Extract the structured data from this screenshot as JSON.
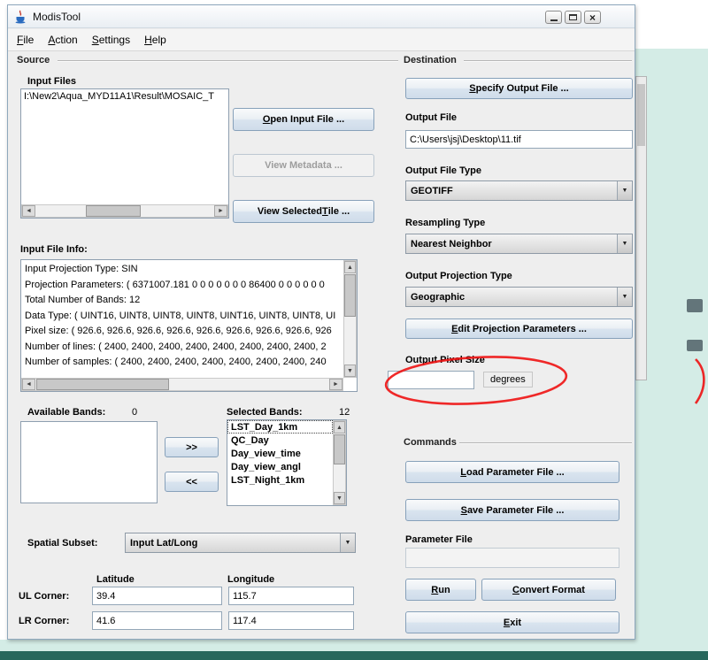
{
  "window": {
    "title": "ModisTool"
  },
  "menu": {
    "items": [
      {
        "label": "File",
        "mi": 0
      },
      {
        "label": "Action",
        "mi": 0
      },
      {
        "label": "Settings",
        "mi": 0
      },
      {
        "label": "Help",
        "mi": 0
      }
    ]
  },
  "source": {
    "section_label": "Source",
    "input_files_label": "Input Files",
    "input_file_path": "I:\\New2\\Aqua_MYD11A1\\Result\\MOSAIC_T",
    "open_button": {
      "label": "Open Input File ...",
      "mi": 0
    },
    "metadata_button": {
      "label": "View Metadata ...",
      "mi": -1
    },
    "view_tile_button": {
      "label": "View Selected Tile ...",
      "mi": 14
    },
    "file_info_label": "Input File Info:",
    "file_info_lines": [
      "Input Projection Type: SIN",
      "Projection Parameters: ( 6371007.181 0 0 0 0 0 0 0 86400 0 0 0 0 0 0",
      "Total Number of Bands: 12",
      "Data Type: ( UINT16, UINT8, UINT8, UINT8, UINT16, UINT8, UINT8, UI",
      "Pixel size: ( 926.6, 926.6, 926.6, 926.6, 926.6, 926.6, 926.6, 926.6, 926",
      "Number of lines: ( 2400, 2400, 2400, 2400, 2400, 2400, 2400, 2400, 2",
      "Number of samples: ( 2400, 2400, 2400, 2400, 2400, 2400, 2400, 240"
    ],
    "available_bands_label": "Available Bands:",
    "available_bands_count": "0",
    "selected_bands_label": "Selected Bands:",
    "selected_bands_count": "12",
    "move_right_label": ">>",
    "move_left_label": "<<",
    "selected_bands": [
      "LST_Day_1km",
      "QC_Day",
      "Day_view_time",
      "Day_view_angl",
      "LST_Night_1km"
    ],
    "spatial_subset_label": "Spatial Subset:",
    "spatial_subset_value": "Input Lat/Long",
    "latitude_label": "Latitude",
    "longitude_label": "Longitude",
    "ul_corner_label": "UL Corner:",
    "lr_corner_label": "LR Corner:",
    "ul_lat": "39.4",
    "ul_lon": "115.7",
    "lr_lat": "41.6",
    "lr_lon": "117.4"
  },
  "destination": {
    "section_label": "Destination",
    "specify_output_button": {
      "label": "Specify Output File ...",
      "mi": 0
    },
    "output_file_label": "Output File",
    "output_file_value": "C:\\Users\\jsj\\Desktop\\11.tif",
    "output_file_type_label": "Output File Type",
    "output_file_type_value": "GEOTIFF",
    "resampling_label": "Resampling Type",
    "resampling_value": "Nearest Neighbor",
    "projection_label": "Output Projection Type",
    "projection_value": "Geographic",
    "edit_projection_button": {
      "label": "Edit Projection Parameters ...",
      "mi": 0
    },
    "pixel_size_label": "Output Pixel Size",
    "pixel_size_value": "",
    "pixel_size_unit": "degrees"
  },
  "commands": {
    "section_label": "Commands",
    "load_button": {
      "label": "Load Parameter File ...",
      "mi": 0
    },
    "save_button": {
      "label": "Save Parameter File ...",
      "mi": 0
    },
    "parameter_file_label": "Parameter File",
    "parameter_file_value": "",
    "run_button": {
      "label": "Run",
      "mi": 0
    },
    "convert_button": {
      "label": "Convert Format",
      "mi": 0
    },
    "exit_button": {
      "label": "Exit",
      "mi": 0
    }
  },
  "annotation": {
    "color": "#ee1212"
  }
}
